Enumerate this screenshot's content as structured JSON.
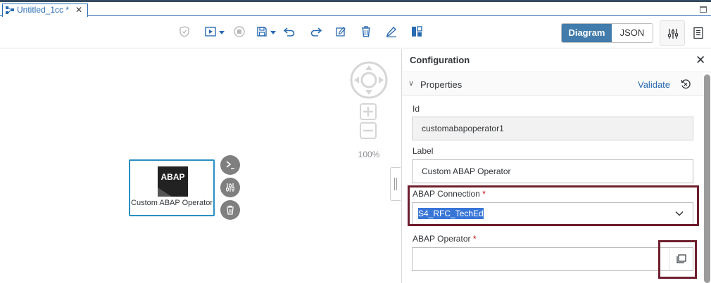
{
  "tab": {
    "title": "Untitled_1cc *",
    "close": "✕"
  },
  "toolbar": {
    "view_diagram": "Diagram",
    "view_json": "JSON"
  },
  "canvas": {
    "zoom_label": "100%",
    "node": {
      "logo_text": "ABAP",
      "label": "Custom ABAP Operator"
    }
  },
  "config": {
    "title": "Configuration",
    "close": "✕",
    "section": {
      "title": "Properties",
      "validate_label": "Validate"
    },
    "fields": {
      "id": {
        "label": "Id",
        "value": "customabapoperator1"
      },
      "label": {
        "label": "Label",
        "value": "Custom ABAP Operator"
      },
      "abap_connection": {
        "label": "ABAP Connection",
        "required": "*",
        "value": "S4_RFC_TechEd"
      },
      "abap_operator": {
        "label": "ABAP Operator",
        "required": "*",
        "value": ""
      }
    }
  },
  "colors": {
    "accent": "#2a6bb1",
    "selected_button": "#427cac",
    "highlight_box": "#6e1e2e",
    "node_border": "#2a8fc2"
  },
  "icons": [
    "graph-icon",
    "shield-icon",
    "run-icon",
    "stop-icon",
    "save-icon",
    "undo-icon",
    "redo-icon",
    "validate-graph-icon",
    "delete-icon",
    "edit-icon",
    "layout-icon",
    "settings-icon",
    "document-icon",
    "navigation-icon",
    "zoom-in-icon",
    "zoom-out-icon",
    "terminal-icon",
    "settings-icon",
    "trash-icon",
    "reset-icon",
    "chevron-down-icon",
    "value-help-icon"
  ]
}
